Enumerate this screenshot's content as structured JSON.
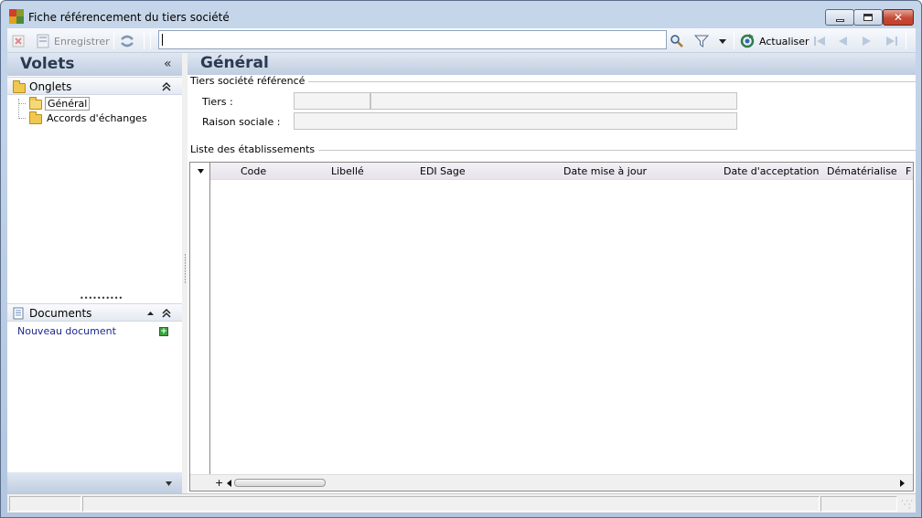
{
  "window": {
    "title": "Fiche référencement du tiers société",
    "minimize_icon": "minimize-icon",
    "maximize_icon": "maximize-icon",
    "close_icon": "close-icon"
  },
  "toolbar": {
    "delete_icon": "delete-icon",
    "save_label": "Enregistrer",
    "refresh_icon": "refresh-icon",
    "search_value": "",
    "search_icon": "magnifier-icon",
    "filter_icon": "funnel-icon",
    "refresh_label": "Actualiser",
    "first_icon": "first-record-icon",
    "prev_icon": "previous-record-icon",
    "next_icon": "next-record-icon",
    "last_icon": "last-record-icon"
  },
  "left_panel": {
    "title": "Volets",
    "collapse_glyph": "«",
    "onglets": {
      "title": "Onglets",
      "items": [
        {
          "label": "Général",
          "selected": true
        },
        {
          "label": "Accords d'échanges",
          "selected": false
        }
      ]
    },
    "documents": {
      "title": "Documents",
      "new_document": "Nouveau document"
    }
  },
  "main": {
    "title": "Général",
    "tiers_group": {
      "title": "Tiers société référencé",
      "tiers_label": "Tiers :",
      "tiers_code": "",
      "tiers_name": "",
      "raison_label": "Raison sociale :",
      "raison_value": ""
    },
    "etablissements": {
      "title": "Liste des établissements",
      "columns": [
        "Code",
        "Libellé",
        "EDI Sage",
        "Date mise à jour",
        "Date d'acceptation",
        "Dématérialise",
        "F"
      ],
      "rows": []
    }
  },
  "colors": {
    "header_gradient_top": "#dfe7f2",
    "header_gradient_bottom": "#bfcde0",
    "title_text": "#2b3a52",
    "link": "#1a2a8c",
    "close_button": "#c44a36"
  }
}
